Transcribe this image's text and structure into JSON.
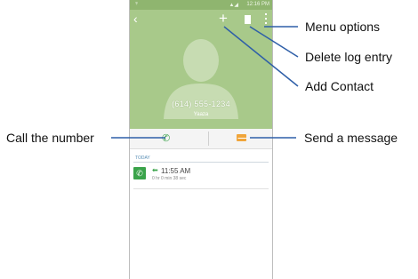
{
  "status_bar": {
    "time": "12:16 PM"
  },
  "contact": {
    "number": "(614) 555-1234",
    "label": "Yaaza"
  },
  "section_header": "TODAY",
  "log_entry": {
    "time": "11:55 AM",
    "duration": "0 hr 0 min 38 sec"
  },
  "callouts": {
    "menu_options": "Menu options",
    "delete_log_entry": "Delete log entry",
    "add_contact": "Add Contact",
    "call_the_number": "Call the number",
    "send_a_message": "Send a message"
  },
  "icons": [
    "back-icon",
    "add-icon",
    "trash-icon",
    "overflow-menu-icon",
    "phone-icon",
    "message-icon",
    "incoming-arrow-icon"
  ],
  "colors": {
    "header_green": "#a8c98a",
    "call_green": "#3aa34a",
    "message_orange": "#f0a53a",
    "callout_line": "#2f5fa8"
  }
}
